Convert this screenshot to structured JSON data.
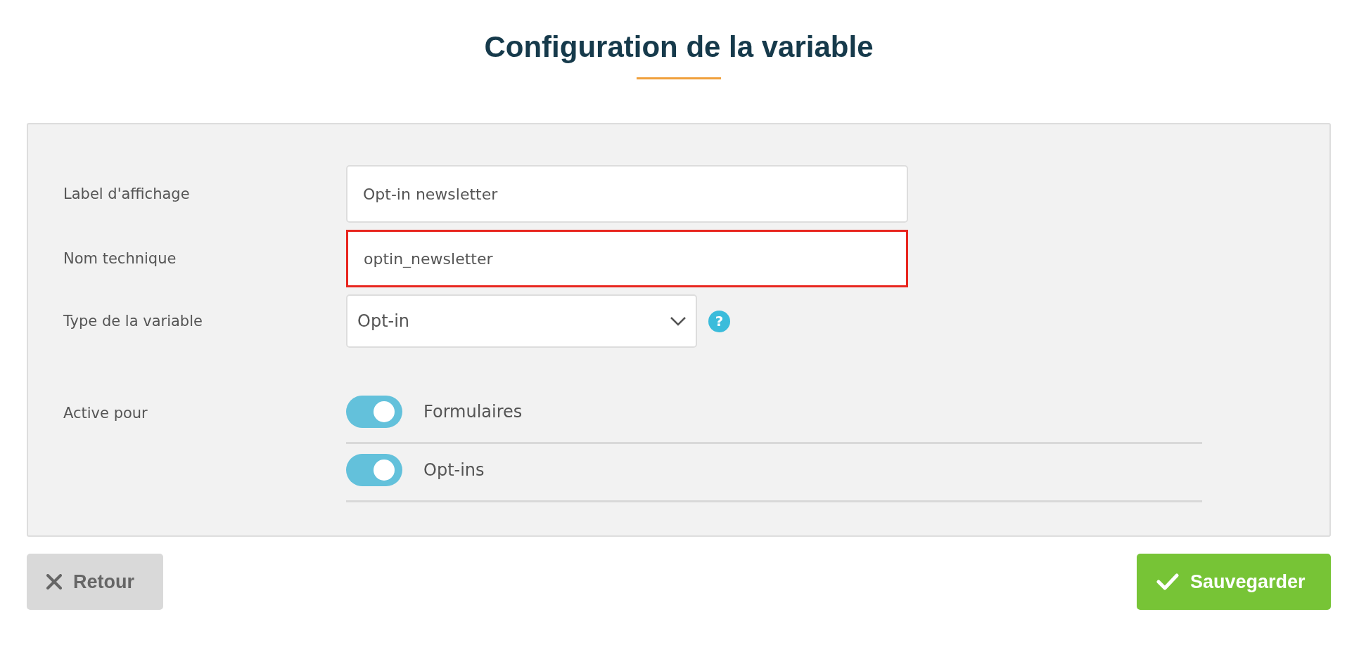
{
  "title": "Configuration de la variable",
  "fields": [
    {
      "kind": "text",
      "label": "Label d'affichage",
      "value": "Opt-in newsletter",
      "invalid": false
    },
    {
      "kind": "text",
      "label": "Nom technique",
      "value": "optin_newsletter",
      "invalid": true
    },
    {
      "kind": "select",
      "label": "Type de la variable",
      "value": "Opt-in",
      "invalid": false,
      "help": "?"
    }
  ],
  "active_for": {
    "label": "Active pour",
    "toggles": [
      {
        "label": "Formulaires",
        "on": true
      },
      {
        "label": "Opt-ins",
        "on": true
      }
    ]
  },
  "buttons": [
    {
      "kind": "back",
      "label": "Retour"
    },
    {
      "kind": "save",
      "label": "Sauvegarder"
    }
  ]
}
